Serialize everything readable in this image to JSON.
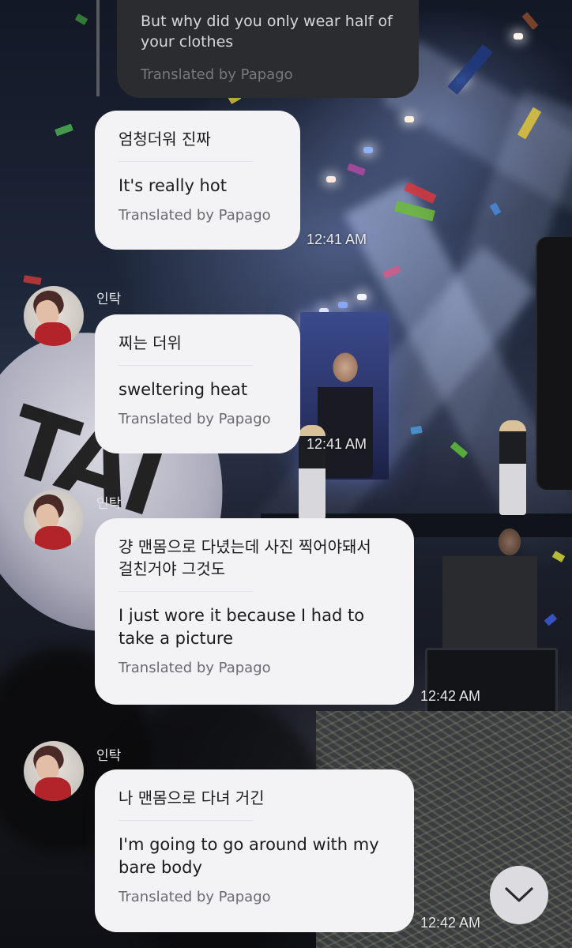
{
  "messages": [
    {
      "translation": "But why did you only wear half of your clothes",
      "credit": "Translated by Papago"
    },
    {
      "original": "엄청더워 진짜",
      "translation": "It's really hot",
      "credit": "Translated by Papago",
      "time": "12:41 AM"
    },
    {
      "sender": "인탁",
      "original": "찌는 더위",
      "translation": "sweltering heat",
      "credit": "Translated by Papago",
      "time": "12:41 AM"
    },
    {
      "sender": "인탁",
      "original": "걍 맨몸으로 다녔는데 사진 찍어야돼서 걸친거야 그것도",
      "translation": "I just wore it because I had to take a picture",
      "credit": "Translated by Papago",
      "time": "12:42 AM"
    },
    {
      "sender": "인탁",
      "original": "나 맨몸으로 다녀 거긴",
      "translation": "I'm going to go around with my bare body",
      "credit": "Translated by Papago",
      "time": "12:42 AM"
    }
  ],
  "icons": {
    "avatar": "avatar-icon",
    "scroll_down": "chevron-down-icon"
  },
  "colors": {
    "bubble_light": "#f3f3f5",
    "bubble_dark": "#2b2c30",
    "timestamp": "#e9e9ec",
    "accent_jacket": "#b3242a"
  }
}
